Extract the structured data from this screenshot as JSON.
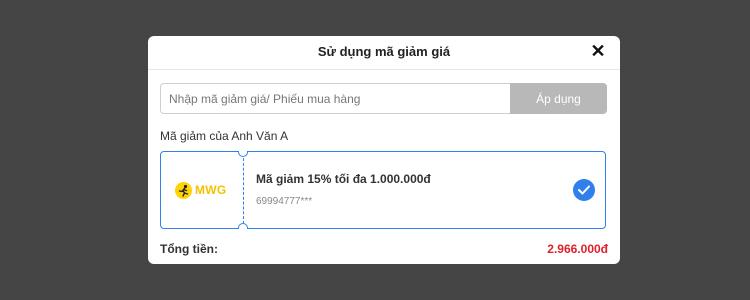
{
  "modal": {
    "title": "Sử dụng mã giảm giá",
    "close_symbol": "✕",
    "input": {
      "placeholder": "Nhập mã giảm giá/ Phiếu mua hàng",
      "value": ""
    },
    "apply_label": "Áp dụng",
    "section_label": "Mã giảm của Anh Văn A",
    "voucher": {
      "logo_text": "MWG",
      "title": "Mã giảm 15% tối đa 1.000.000đ",
      "code": "69994777***",
      "selected": true
    },
    "total_label": "Tổng tiền:",
    "total_value": "2.966.000đ"
  },
  "colors": {
    "accent": "#2f80ed",
    "price": "#e0202a",
    "logo_yellow": "#ffd400",
    "apply_button": "#b8b8b8"
  },
  "icons": [
    "close-icon",
    "mwg-logo-icon",
    "check-icon"
  ]
}
